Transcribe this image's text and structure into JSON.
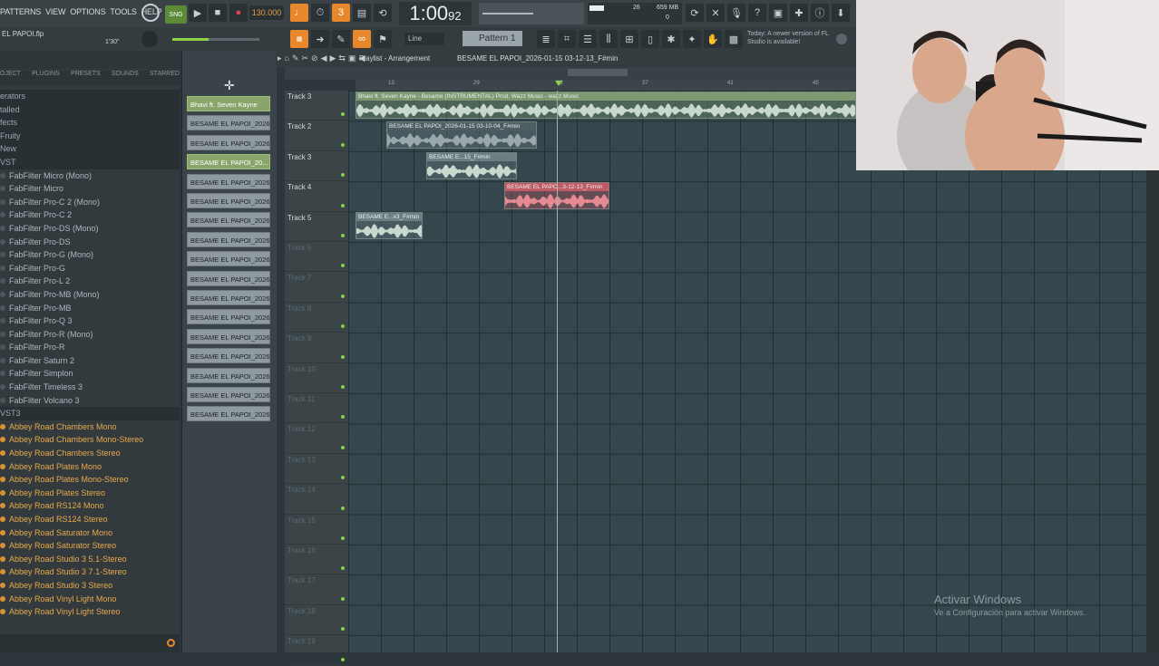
{
  "menu": [
    "PATTERNS",
    "VIEW",
    "OPTIONS",
    "TOOLS",
    "HELP"
  ],
  "transport": {
    "tempo": "130.000",
    "time_main": "1:00",
    "time_sub": "92",
    "pattern": "Pattern 1",
    "snap": "Line",
    "cpu": "659 MB",
    "cpu2": "0",
    "meter": "26"
  },
  "project": {
    "name": "EL PAPOI.flp",
    "offset": "1'30\"",
    "news": "Today: A newer version of FL Studio is available!"
  },
  "playlist": {
    "title": "Playlist - Arrangement",
    "pattern_path": "BESAME EL PAPOI_2026-01-15 03-12-13_F#min"
  },
  "browser": {
    "tabs": [
      "OJECT",
      "PLUGINS",
      "PRESETS",
      "SOUNDS",
      "STARRED"
    ],
    "items": [
      {
        "label": "erators",
        "type": "cat"
      },
      {
        "label": "talled",
        "type": "cat"
      },
      {
        "label": "fects",
        "type": "cat"
      },
      {
        "label": "Fruity",
        "type": "cat"
      },
      {
        "label": "New",
        "type": "cat"
      },
      {
        "label": "VST",
        "type": "cat"
      },
      {
        "label": "FabFilter Micro (Mono)",
        "type": "item"
      },
      {
        "label": "FabFilter Micro",
        "type": "item"
      },
      {
        "label": "FabFilter Pro-C 2 (Mono)",
        "type": "item"
      },
      {
        "label": "FabFilter Pro-C 2",
        "type": "item"
      },
      {
        "label": "FabFilter Pro-DS (Mono)",
        "type": "item"
      },
      {
        "label": "FabFilter Pro-DS",
        "type": "item"
      },
      {
        "label": "FabFilter Pro-G (Mono)",
        "type": "item"
      },
      {
        "label": "FabFilter Pro-G",
        "type": "item"
      },
      {
        "label": "FabFilter Pro-L 2",
        "type": "item"
      },
      {
        "label": "FabFilter Pro-MB (Mono)",
        "type": "item"
      },
      {
        "label": "FabFilter Pro-MB",
        "type": "item"
      },
      {
        "label": "FabFilter Pro-Q 3",
        "type": "item"
      },
      {
        "label": "FabFilter Pro-R (Mono)",
        "type": "item"
      },
      {
        "label": "FabFilter Pro-R",
        "type": "item"
      },
      {
        "label": "FabFilter Saturn 2",
        "type": "item"
      },
      {
        "label": "FabFilter Simplon",
        "type": "item"
      },
      {
        "label": "FabFilter Timeless 3",
        "type": "item"
      },
      {
        "label": "FabFilter Volcano 3",
        "type": "item"
      },
      {
        "label": "VST3",
        "type": "cat"
      },
      {
        "label": "Abbey Road Chambers Mono",
        "type": "hl"
      },
      {
        "label": "Abbey Road Chambers Mono-Stereo",
        "type": "hl"
      },
      {
        "label": "Abbey Road Chambers Stereo",
        "type": "hl"
      },
      {
        "label": "Abbey Road Plates Mono",
        "type": "hl"
      },
      {
        "label": "Abbey Road Plates Mono-Stereo",
        "type": "hl"
      },
      {
        "label": "Abbey Road Plates Stereo",
        "type": "hl"
      },
      {
        "label": "Abbey Road RS124 Mono",
        "type": "hl"
      },
      {
        "label": "Abbey Road RS124 Stereo",
        "type": "hl"
      },
      {
        "label": "Abbey Road Saturator Mono",
        "type": "hl"
      },
      {
        "label": "Abbey Road Saturator Stereo",
        "type": "hl"
      },
      {
        "label": "Abbey Road Studio 3 5.1-Stereo",
        "type": "hl"
      },
      {
        "label": "Abbey Road Studio 3 7.1-Stereo",
        "type": "hl"
      },
      {
        "label": "Abbey Road Studio 3 Stereo",
        "type": "hl"
      },
      {
        "label": "Abbey Road Vinyl Light Mono",
        "type": "hl"
      },
      {
        "label": "Abbey Road Vinyl Light Stereo",
        "type": "hl"
      }
    ]
  },
  "channels": [
    {
      "label": "Bhavi ft. Seven Kayne",
      "green": true
    },
    {
      "label": "BESAME EL PAPOI_2026-...",
      "green": false
    },
    {
      "label": "BESAME EL PAPOI_2026-...",
      "green": false
    },
    {
      "label": "BESAME EL PAPOI_20...",
      "green": true
    },
    {
      "label": "BESAME EL PAPOI_2026-...",
      "green": false
    },
    {
      "label": "BESAME EL PAPOI_2026-...",
      "green": false
    },
    {
      "label": "BESAME EL PAPOI_2026-...",
      "green": false
    },
    {
      "label": "BESAME EL PAPOI_2026-...",
      "green": false
    },
    {
      "label": "BESAME EL PAPOI_2026-...",
      "green": false
    },
    {
      "label": "BESAME EL PAPOI_2026-...",
      "green": false
    },
    {
      "label": "BESAME EL PAPOI_2026-...",
      "green": false
    },
    {
      "label": "BESAME EL PAPOI_2026-...",
      "green": false
    },
    {
      "label": "BESAME EL PAPOI_2026-...",
      "green": false
    },
    {
      "label": "BESAME EL PAPOI_2026-...",
      "green": false
    },
    {
      "label": "BESAME EL PAPOI_2026-...",
      "green": false
    },
    {
      "label": "BESAME EL PAPOI_2026-...",
      "green": false
    },
    {
      "label": "BESAME EL PAPOI_2026-...",
      "green": false
    }
  ],
  "tracks": [
    "Track 3",
    "Track 2",
    "Track 3",
    "Track 4",
    "Track 5",
    "Track 6",
    "Track 7",
    "Track 8",
    "Track 9",
    "Track 10",
    "Track 11",
    "Track 12",
    "Track 13",
    "Track 14",
    "Track 15",
    "Track 16",
    "Track 17",
    "Track 18",
    "Track 19"
  ],
  "ruler_marks": [
    "13",
    "29",
    "33",
    "37",
    "41",
    "45",
    "49"
  ],
  "clips": [
    {
      "label": "Bhavi ft. Seven Kayne - Besame (INSTRUMENTAL) Prod. Wazz Music - wazz Music",
      "color": "#7f9a70"
    },
    {
      "label": "BESAME EL PAPOI_2026-01-15 03-10-04_F#min",
      "color": "#4e5e62"
    },
    {
      "label": "BESAME E...15_F#min",
      "color": "#6d7f83"
    },
    {
      "label": "BESAME EL PAPO...3-12-13_F#min",
      "color": "#c05a63"
    },
    {
      "label": "BESAME E...x3_F#min",
      "color": "#6d7f83"
    }
  ],
  "windows": {
    "line1": "Activar Windows",
    "line2": "Ve a Configuración para activar Windows."
  },
  "colors": {
    "accent": "#e8872b",
    "grid": "#34474c",
    "clip_red": "#c05a63",
    "clip_green": "#7f9a70"
  }
}
